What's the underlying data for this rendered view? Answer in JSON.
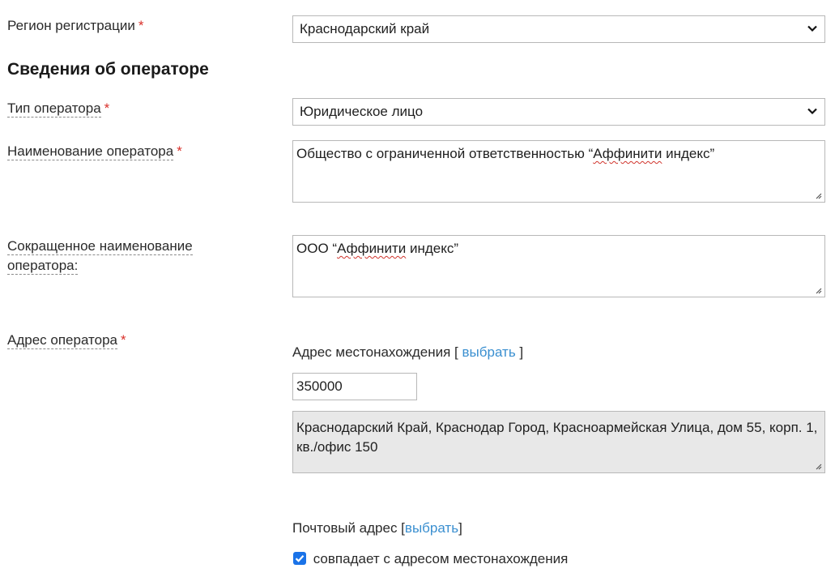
{
  "region": {
    "label": "Регион регистрации",
    "required_mark": "*",
    "selected": "Краснодарский край"
  },
  "section_heading": "Сведения об операторе",
  "operator_type": {
    "label": "Тип оператора",
    "required_mark": "*",
    "selected": "Юридическое лицо"
  },
  "operator_name": {
    "label": "Наименование оператора",
    "required_mark": "*",
    "value_prefix": "Общество с ограниченной ответственностью “",
    "value_marked": "Аффинити",
    "value_suffix": "  индекс”"
  },
  "short_name": {
    "label_line1": "Сокращенное наименование",
    "label_line2": "оператора:",
    "value_prefix": "ООО “",
    "value_marked": "Аффинити",
    "value_suffix": "  индекс”"
  },
  "address": {
    "label": "Адрес оператора",
    "required_mark": "*",
    "location_caption": "Адрес местонахождения [ ",
    "location_link": "выбрать",
    "location_caption_end": " ]",
    "postal_code": "350000",
    "full_address": "Краснодарский Край, Краснодар Город, Красноармейская Улица, дом 55, корп. 1, кв./офис 150",
    "postal_caption": "Почтовый адрес [",
    "postal_link": "выбрать",
    "postal_caption_end": "]",
    "same_as_location_label": "совпадает с адресом местонахождения",
    "same_as_location_checked": true
  },
  "colors": {
    "accent": "#1a73e8",
    "link": "#3a8fd0",
    "required": "#d9302a"
  }
}
